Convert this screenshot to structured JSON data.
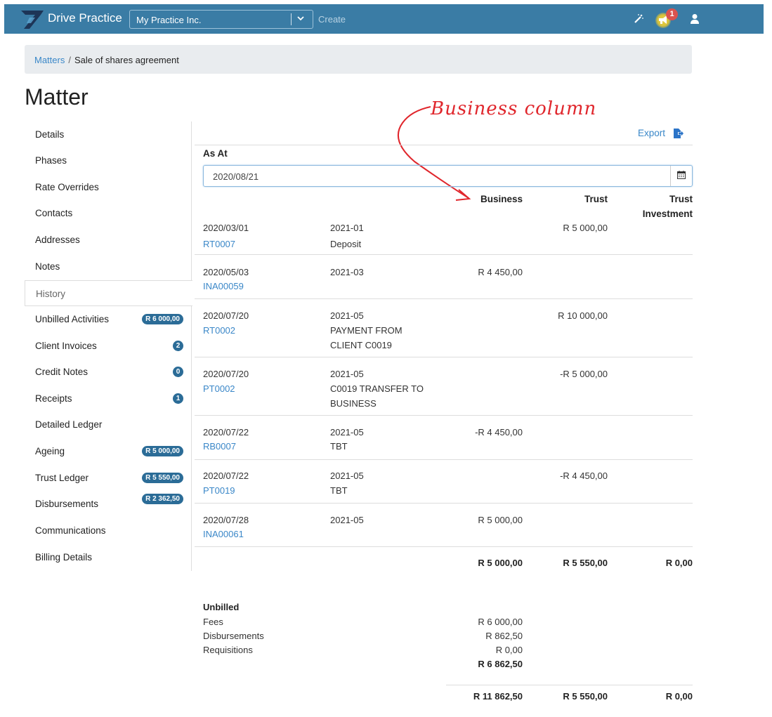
{
  "topbar": {
    "brand": "Drive Practice",
    "org": "My Practice Inc.",
    "create": "Create",
    "notification_count": "1",
    "icons": [
      "magic-wand-icon",
      "megaphone-icon",
      "user-icon",
      "chevron-down-icon"
    ]
  },
  "breadcrumb": {
    "parent": "Matters",
    "current": "Sale of shares agreement"
  },
  "page_title": "Matter",
  "annotation": "Business column",
  "sidebar": {
    "items": [
      {
        "label": "Details"
      },
      {
        "label": "Phases"
      },
      {
        "label": "Rate Overrides"
      },
      {
        "label": "Contacts"
      },
      {
        "label": "Addresses"
      },
      {
        "label": "Notes"
      },
      {
        "label": "History"
      },
      {
        "label": "Unbilled Activities",
        "badge": "R 6 000,00"
      },
      {
        "label": "Client Invoices",
        "badge": "2"
      },
      {
        "label": "Credit Notes",
        "badge": "0"
      },
      {
        "label": "Receipts",
        "badge": "1"
      },
      {
        "label": "Detailed Ledger"
      },
      {
        "label": "Ageing",
        "badge": "R 5 000,00"
      },
      {
        "label": "Trust Ledger",
        "badge": "R 5 550,00"
      },
      {
        "label": "Disbursements",
        "badge": "R 2 362,50"
      },
      {
        "label": "Communications"
      },
      {
        "label": "Billing Details"
      }
    ],
    "active": "History"
  },
  "main": {
    "export_label": "Export",
    "as_at_label": "As At",
    "as_at_value": "2020/08/21",
    "columns": {
      "business": "Business",
      "trust": "Trust",
      "trust_inv_1": "Trust",
      "trust_inv_2": "Investment"
    },
    "rows": [
      {
        "date": "2020/03/01",
        "ref": "RT0007",
        "period": "2021-01",
        "desc": [
          "Deposit"
        ],
        "business": "",
        "trust": "R 5 000,00"
      },
      {
        "date": "2020/05/03",
        "ref": "INA00059",
        "period": "2021-03",
        "desc": [],
        "business": "R 4 450,00",
        "trust": ""
      },
      {
        "date": "2020/07/20",
        "ref": "RT0002",
        "period": "2021-05",
        "desc": [
          "PAYMENT FROM",
          "CLIENT C0019"
        ],
        "business": "",
        "trust": "R 10 000,00"
      },
      {
        "date": "2020/07/20",
        "ref": "PT0002",
        "period": "2021-05",
        "desc": [
          "C0019 TRANSFER TO",
          "BUSINESS"
        ],
        "business": "",
        "trust": "-R 5 000,00"
      },
      {
        "date": "2020/07/22",
        "ref": "RB0007",
        "period": "2021-05",
        "desc": [
          "TBT"
        ],
        "business": "-R 4 450,00",
        "trust": ""
      },
      {
        "date": "2020/07/22",
        "ref": "PT0019",
        "period": "2021-05",
        "desc": [
          "TBT"
        ],
        "business": "",
        "trust": "-R 4 450,00"
      },
      {
        "date": "2020/07/28",
        "ref": "INA00061",
        "period": "2021-05",
        "desc": [],
        "business": "R 5 000,00",
        "trust": ""
      }
    ],
    "totals": {
      "business": "R 5 000,00",
      "trust": "R 5 550,00",
      "trust_inv": "R 0,00"
    },
    "unbilled": {
      "title": "Unbilled",
      "lines": [
        {
          "label": "Fees",
          "value": "R 6 000,00"
        },
        {
          "label": "Disbursements",
          "value": "R 862,50"
        },
        {
          "label": "Requisitions",
          "value": "R 0,00"
        }
      ],
      "total": "R 6 862,50"
    },
    "grand_totals": {
      "business": "R 11 862,50",
      "trust": "R 5 550,00",
      "trust_inv": "R 0,00"
    }
  }
}
